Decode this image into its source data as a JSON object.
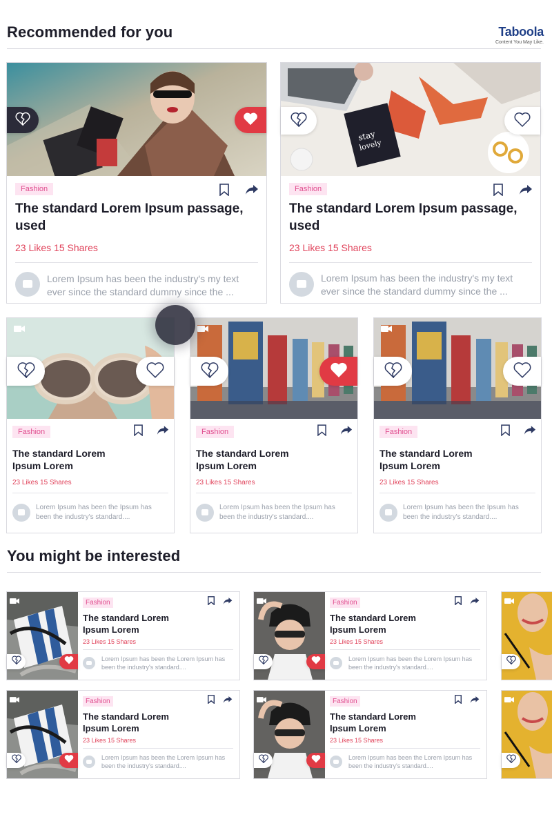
{
  "sections": {
    "recommended_title": "Recommended for you",
    "interested_title": "You might be interested"
  },
  "brand": {
    "name": "Taboola",
    "tagline": "Content You May Like.",
    "color": "#1f3f87"
  },
  "colors": {
    "tag_bg": "#fde4f1",
    "tag_text": "#e04f8f",
    "stats": "#e0425a",
    "heart_red": "#e13a44",
    "dark_pill": "#2b2b39"
  },
  "big_cards": [
    {
      "tag": "Fashion",
      "title": "The standard Lorem Ipsum passage, used",
      "stats": "23 Likes 15 Shares",
      "comment": "Lorem Ipsum has been the industry's my text ever since the standard dummy since the ..."
    },
    {
      "tag": "Fashion",
      "title": "The standard Lorem Ipsum passage, used",
      "stats": "23 Likes 15 Shares",
      "comment": "Lorem Ipsum has been the industry's my text ever since the standard dummy since the ..."
    }
  ],
  "mid_cards": [
    {
      "tag": "Fashion",
      "title": "The standard Lorem Ipsum Lorem",
      "stats": "23 Likes 15 Shares",
      "comment": "Lorem Ipsum has been the  Ipsum has been the industry's standard...."
    },
    {
      "tag": "Fashion",
      "title": "The standard Lorem Ipsum Lorem",
      "stats": "23 Likes 15 Shares",
      "comment": "Lorem Ipsum has been the  Ipsum has been the industry's standard...."
    },
    {
      "tag": "Fashion",
      "title": "The standard Lorem Ipsum Lorem",
      "stats": "23 Likes 15 Shares",
      "comment": "Lorem Ipsum has been the  Ipsum has been the industry's standard...."
    }
  ],
  "small_cards": [
    {
      "tag": "Fashion",
      "title": "The standard Lorem Ipsum Lorem",
      "stats": "23 Likes 15 Shares",
      "comment": "Lorem Ipsum has been the Lorem Ipsum has been the industry's standard...."
    },
    {
      "tag": "Fashion",
      "title": "The standard Lorem Ipsum Lorem",
      "stats": "23 Likes 15 Shares",
      "comment": "Lorem Ipsum has been the Lorem Ipsum has been the industry's standard...."
    },
    {
      "tag": "Fashion",
      "title": "The standard Lorem Ipsum Lorem",
      "stats": "23 Likes 15 Shares",
      "comment": "Lorem Ipsum has been the Lorem Ipsum has been the industry's standard...."
    },
    {
      "tag": "Fashion",
      "title": "The standard Lorem Ipsum Lorem",
      "stats": "23 Likes 15 Shares",
      "comment": "Lorem Ipsum has been the Lorem Ipsum has been the industry's standard...."
    }
  ],
  "icons": [
    "broken-heart-icon",
    "heart-icon",
    "bookmark-icon",
    "share-icon",
    "comment-icon",
    "video-camera-icon"
  ]
}
